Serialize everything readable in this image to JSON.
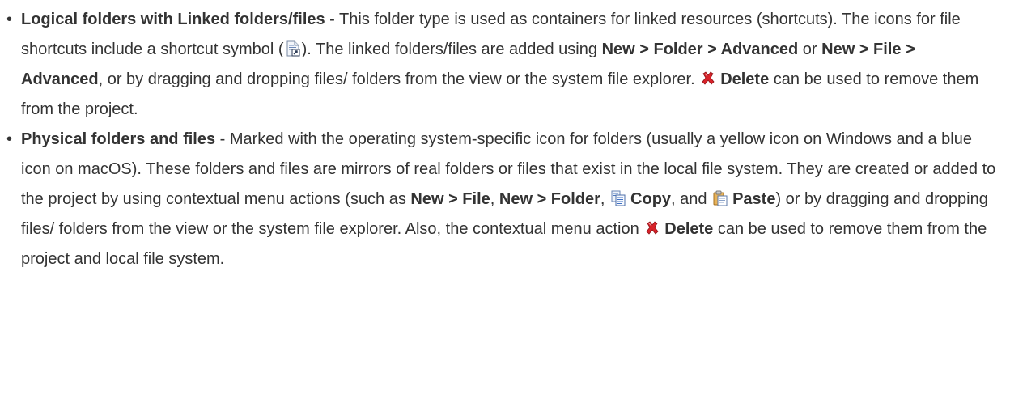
{
  "items": [
    {
      "title": "Logical folders with Linked folders/files",
      "t1": " - This folder type is used as containers for linked resources (shortcuts). The icons for file shortcuts include a shortcut symbol (",
      "shortcut_icon": "file-shortcut-icon",
      "t2": "). The linked folders/files are added using ",
      "b1": "New > Folder > Advanced",
      "t3": " or ",
      "b2": "New > File > Advanced",
      "t4": ", or by dragging and dropping files/ folders from the view or the system file explorer. ",
      "delete_icon": "delete-icon",
      "b3": "Delete",
      "t5": " can be used to remove them from the project."
    },
    {
      "title": "Physical folders and files",
      "t1": " - Marked with the operating system-specific icon for folders (usually a yellow icon on Windows and a blue icon on macOS). These folders and files are mirrors of real folders or files that exist in the local file system. They are created or added to the project by using contextual menu actions (such as ",
      "b1": "New > File",
      "t2": ", ",
      "b2": "New > Folder",
      "t3": ", ",
      "copy_icon": "copy-icon",
      "b3": "Copy",
      "t4": ", and ",
      "paste_icon": "paste-icon",
      "b4": "Paste",
      "t5": ") or by dragging and dropping files/ folders from the view or the system file explorer. Also, the contextual menu action ",
      "delete_icon": "delete-icon",
      "b5": "Delete",
      "t6": " can be used to remove them from the project and local file system."
    }
  ],
  "bullet_char": "•",
  "colors": {
    "text": "#333333",
    "delete_red": "#d9232a"
  }
}
